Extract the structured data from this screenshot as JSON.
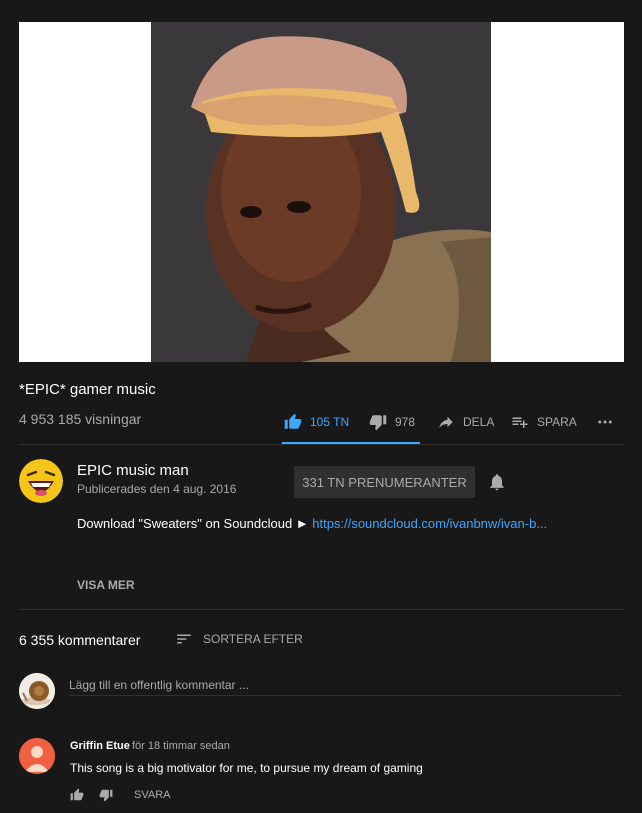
{
  "video": {
    "title": "*EPIC* gamer music",
    "views": "4 953 185 visningar"
  },
  "actions": {
    "like_count": "105 TN",
    "dislike_count": "978",
    "share_label": "DELA",
    "save_label": "SPARA"
  },
  "channel": {
    "name": "EPIC music man",
    "published": "Publicerades den 4 aug. 2016",
    "subscribe_label": "331 TN PRENUMERANTER"
  },
  "description": {
    "text": "Download \"Sweaters\" on Soundcloud ► ",
    "link": "https://soundcloud.com/ivanbnw/ivan-b...",
    "show_more": "VISA MER"
  },
  "comments": {
    "count": "6 355 kommentarer",
    "sort_label": "SORTERA EFTER",
    "input_placeholder": "Lägg till en offentlig kommentar ...",
    "items": [
      {
        "author": "Griffin Etue",
        "time": "för 18 timmar sedan",
        "text": "This song is a big motivator for me, to pursue my dream of gaming",
        "reply_label": "SVARA"
      }
    ]
  },
  "colors": {
    "background": "#181818",
    "accent": "#3ea6ff",
    "secondary_text": "#aaaaaa"
  }
}
